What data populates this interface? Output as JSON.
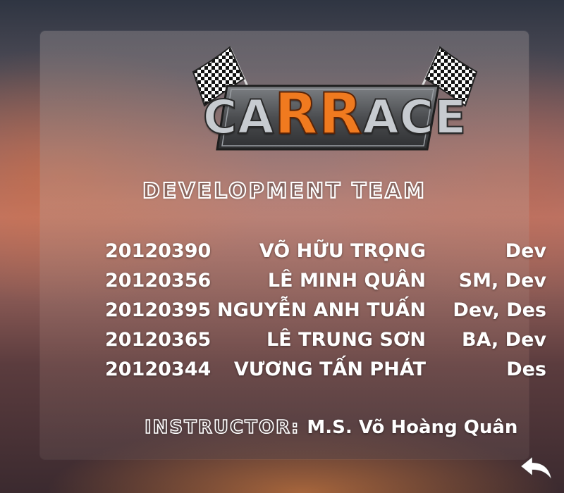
{
  "logo": {
    "text_pre": "CA",
    "text_highlight": "RR",
    "text_post": "ACE",
    "icon_left": "checkered-flag-icon",
    "icon_right": "checkered-flag-icon"
  },
  "section_title": "DEVELOPMENT TEAM",
  "team": [
    {
      "id": "20120390",
      "name": "VÕ HỮU TRỌNG",
      "role": "Dev"
    },
    {
      "id": "20120356",
      "name": "LÊ MINH QUÂN",
      "role": "SM, Dev"
    },
    {
      "id": "20120395",
      "name": "NGUYỄN ANH TUẤN",
      "role": "Dev, Des"
    },
    {
      "id": "20120365",
      "name": "LÊ TRUNG SƠN",
      "role": "BA, Dev"
    },
    {
      "id": "20120344",
      "name": "VƯƠNG TẤN PHÁT",
      "role": "Des"
    }
  ],
  "instructor": {
    "label": "INSTRUCTOR:",
    "name": "M.S. Võ Hoàng Quân"
  },
  "back_button": {
    "icon": "back-arrow-icon"
  },
  "colors": {
    "logo_accent": "#f07a1f",
    "logo_metal": "#c7cbd0",
    "text": "#ffffff"
  }
}
